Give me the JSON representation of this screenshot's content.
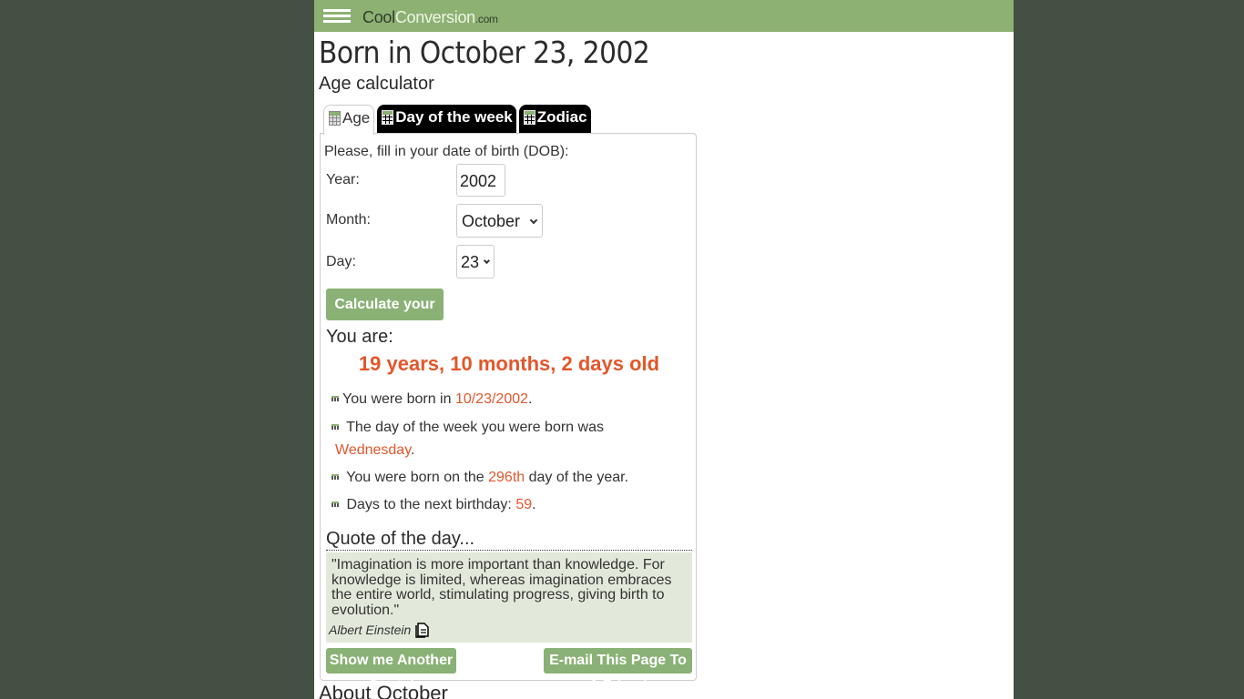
{
  "header": {
    "logo_cool": "Cool",
    "logo_conversion": "Conversion",
    "logo_com": ".com",
    "menu_icon": "hamburger-menu-icon"
  },
  "page": {
    "title": "Born in October 23, 2002",
    "subtitle": "Age calculator"
  },
  "tabs": [
    {
      "label": "Age",
      "icon": "table-icon",
      "active": true
    },
    {
      "label": "Day of the week",
      "icon": "table-icon",
      "active": false
    },
    {
      "label": "Zodiac",
      "icon": "table-icon",
      "active": false
    }
  ],
  "form": {
    "intro": "Please, fill in your date of birth (DOB):",
    "year_label": "Year:",
    "year_value": "2002",
    "month_label": "Month:",
    "month_value": "October",
    "day_label": "Day:",
    "day_value": "23",
    "calculate_button": "Calculate your Age!"
  },
  "result": {
    "heading": "You are:",
    "age": "19 years, 10 months, 2 days old",
    "facts": [
      {
        "prefix": "You were born in ",
        "value": "10/23/2002",
        "suffix": "."
      },
      {
        "prefix": " The day of the week you were born was ",
        "value": "Wednesday",
        "suffix": "."
      },
      {
        "prefix": " You were born on the ",
        "value": "296th",
        "suffix": " day of the year."
      },
      {
        "prefix": " Days to the next birthday: ",
        "value": "59",
        "suffix": "."
      }
    ]
  },
  "quote": {
    "heading": "Quote of the day...",
    "text": "\"Imagination is more important than knowledge. For knowledge is limited, whereas imagination embraces the entire world, stimulating progress, giving birth to evolution.\"",
    "author": "Albert Einstein",
    "another_button": "Show me Another Quote!",
    "email_button": "E-mail This Page To A Friend"
  },
  "next_section": {
    "heading": "About October"
  },
  "colors": {
    "header_bg": "#8db173",
    "accent_orange": "#e2572b",
    "button_green": "#8ab176",
    "outer_bg": "#435043",
    "quote_bg": "#e2e9da"
  }
}
